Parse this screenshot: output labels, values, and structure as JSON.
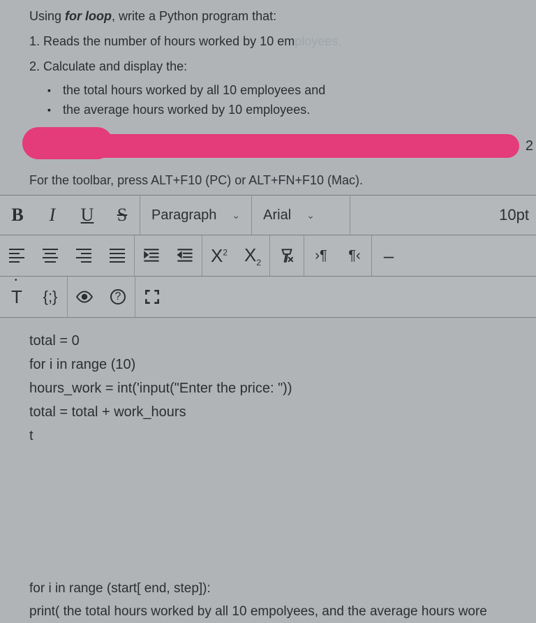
{
  "question": {
    "title_html": "Using <span class='bold ital'>for loop</span>, write a Python program that:",
    "item1_html": "1. Reads the number of hours worked by 10 em<span class='faded'>ployees.</span>",
    "item2": "2. Calculate and display the:",
    "bullet1": "the total hours worked by all 10 employees and",
    "bullet2": "the average hours worked by 10 employees."
  },
  "redaction": {
    "badge": "2"
  },
  "toolbar_hint": "For the toolbar, press ALT+F10 (PC) or ALT+FN+F10 (Mac).",
  "toolbar": {
    "bold": "B",
    "italic": "I",
    "underline": "U",
    "strike": "S",
    "block_format": "Paragraph",
    "font_family": "Arial",
    "font_size": "10pt",
    "superscript": "X",
    "subscript": "X",
    "remove_format": "–",
    "accessibility": "T",
    "codesample": "{;}",
    "preview": "◉",
    "help": "?"
  },
  "content": {
    "l0": "total = 0",
    "l1": "for i in range (10)",
    "l2": "hours_work = int('input(\"Enter the price: \"))",
    "l3": "total = total + work_hours",
    "l4": "t"
  },
  "footer": {
    "l0": "for i in range (start[ end, step]):",
    "l1": "print( the total hours worked by all 10 empolyees, and the average hours wore"
  }
}
